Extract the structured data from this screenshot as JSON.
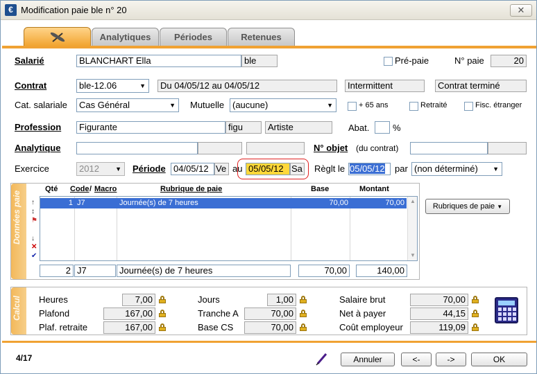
{
  "window": {
    "title": "Modification paie ble n° 20",
    "close": "✕"
  },
  "tabs": [
    "Analytiques",
    "Périodes",
    "Retenues"
  ],
  "salarie": {
    "label": "Salarié",
    "name": "BLANCHART Ella",
    "code": "ble",
    "prepaie_label": "Pré-paie",
    "npaie_label": "N° paie",
    "npaie": "20"
  },
  "contrat": {
    "label": "Contrat",
    "value": "ble-12.06",
    "dates": "Du 04/05/12 au 04/05/12",
    "type": "Intermittent",
    "status": "Contrat terminé"
  },
  "cat": {
    "label": "Cat. salariale",
    "value": "Cas Général",
    "mutuelle_label": "Mutuelle",
    "mutuelle": "(aucune)",
    "plus65": "+ 65 ans",
    "retraite": "Retraité",
    "fisc": "Fisc. étranger"
  },
  "profession": {
    "label": "Profession",
    "value": "Figurante",
    "code": "figu",
    "cat": "Artiste",
    "abat_label": "Abat.",
    "abat_unit": "%"
  },
  "analytique": {
    "label": "Analytique",
    "nobjet_label": "N° objet",
    "nobjet_hint": "(du contrat)"
  },
  "periode": {
    "exercice_label": "Exercice",
    "exercice": "2012",
    "label": "Période",
    "from": "04/05/12",
    "from_day": "Ve",
    "au": "au",
    "to": "05/05/12",
    "to_day": "Sa",
    "reglt_label": "Règlt le",
    "reglt": "05/05/12",
    "par_label": "par",
    "par": "(non déterminé)"
  },
  "donnees": {
    "side": "Données paie",
    "headers": {
      "qte": "Qté",
      "code": "Code",
      "macro": "Macro",
      "rubrique": "Rubrique de paie",
      "base": "Base",
      "montant": "Montant"
    },
    "rows": [
      {
        "qte": "1",
        "code": "J7",
        "rubrique": "Journée(s) de 7 heures",
        "base": "70,00",
        "montant": "70,00"
      }
    ],
    "edit": {
      "qte": "2",
      "code": "J7",
      "rubrique": "Journée(s) de 7 heures",
      "base": "70,00",
      "montant": "140,00"
    },
    "rubriques_btn": "Rubriques de paie"
  },
  "calcul": {
    "side": "Calcul",
    "heures_label": "Heures",
    "heures": "7,00",
    "plafond_label": "Plafond",
    "plafond": "167,00",
    "plafret_label": "Plaf. retraite",
    "plafret": "167,00",
    "jours_label": "Jours",
    "jours": "1,00",
    "trancheA_label": "Tranche A",
    "trancheA": "70,00",
    "baseCS_label": "Base CS",
    "baseCS": "70,00",
    "brut_label": "Salaire brut",
    "brut": "70,00",
    "net_label": "Net à payer",
    "net": "44,15",
    "cout_label": "Coût employeur",
    "cout": "119,09"
  },
  "footer": {
    "page": "4/17",
    "annuler": "Annuler",
    "prev": "<-",
    "next": "->",
    "ok": "OK"
  }
}
